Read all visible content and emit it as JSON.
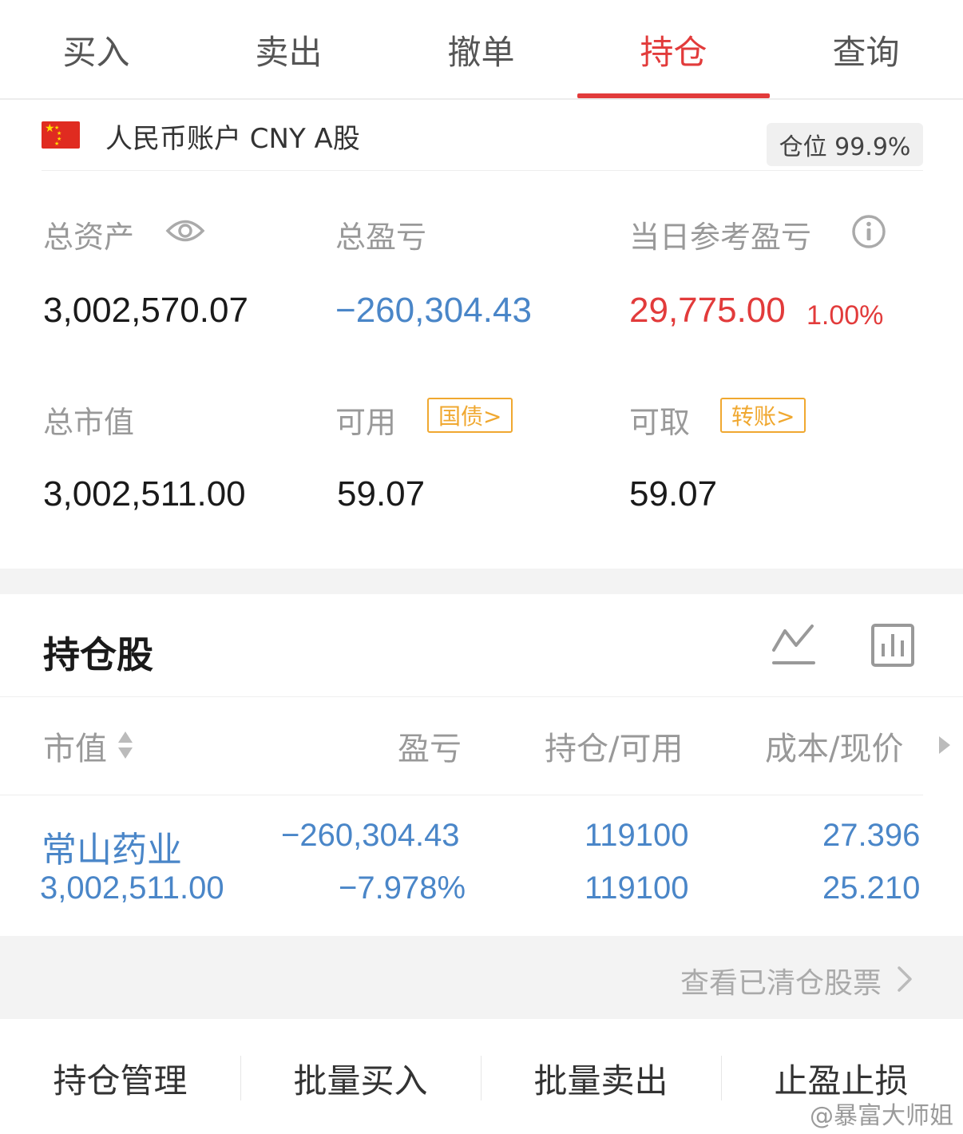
{
  "tabs": [
    {
      "label": "买入"
    },
    {
      "label": "卖出"
    },
    {
      "label": "撤单"
    },
    {
      "label": "持仓",
      "active": true
    },
    {
      "label": "查询"
    }
  ],
  "account": {
    "name": "人民币账户 CNY A股",
    "position_label": "仓位 99.9%"
  },
  "summary": {
    "total_assets_label": "总资产",
    "total_assets_value": "3,002,570.07",
    "total_pnl_label": "总盈亏",
    "total_pnl_value": "−260,304.43",
    "daily_pnl_label": "当日参考盈亏",
    "daily_pnl_value": "29,775.00",
    "daily_pnl_pct": "1.00%",
    "market_value_label": "总市值",
    "market_value_value": "3,002,511.00",
    "available_label": "可用",
    "available_tag": "国债>",
    "available_value": "59.07",
    "withdrawable_label": "可取",
    "withdrawable_tag": "转账>",
    "withdrawable_value": "59.07"
  },
  "holdings": {
    "title": "持仓股",
    "columns": [
      "市值",
      "盈亏",
      "持仓/可用",
      "成本/现价"
    ],
    "rows": [
      {
        "name": "常山药业",
        "market_value": "3,002,511.00",
        "pnl": "−260,304.43",
        "pnl_pct": "−7.978%",
        "position": "119100",
        "available": "119100",
        "cost": "27.396",
        "price": "25.210"
      }
    ],
    "cleared_link": "查看已清仓股票"
  },
  "actions": [
    {
      "label": "持仓管理"
    },
    {
      "label": "批量买入"
    },
    {
      "label": "批量卖出"
    },
    {
      "label": "止盈止损"
    }
  ],
  "watermark": "@暴富大师姐",
  "colors": {
    "accent_red": "#e23b3b",
    "loss_blue": "#4a86c8",
    "tag_orange": "#f0a830"
  }
}
